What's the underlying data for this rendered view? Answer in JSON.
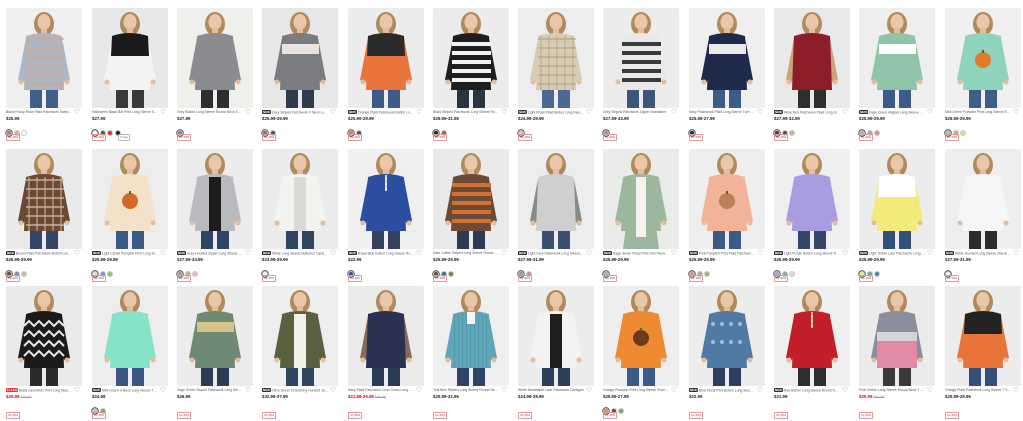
{
  "products": [
    {
      "row": 0,
      "col": 0,
      "title": "Black Friday Rose Plaid Patchwork Sweatshirt Pullover",
      "badge": "",
      "price": "$25.99",
      "orig": "",
      "sale": false,
      "top": "#a9b8c6",
      "accent": "#d9a38f",
      "pattern": "plaid",
      "pants": "#3f5f8c",
      "bg": "#efefef",
      "swatches": [
        "#8a8a8a",
        "#c8b9a6",
        "#ffffff"
      ],
      "promo": "Up 30%",
      "promo2": ""
    },
    {
      "row": 0,
      "col": 1,
      "title": "Halloween Black Bat Print Long Sleeve Sweatshirt",
      "badge": "",
      "price": "$27.99",
      "orig": "",
      "sale": false,
      "top": "#f4f4f4",
      "accent": "#1a1a1a",
      "pattern": "yoke",
      "pants": "#3a3a3a",
      "bg": "#e8e8e8",
      "swatches": [
        "#ffffff",
        "#2a7a3a",
        "#d33",
        "#222"
      ],
      "promo": "Up 30%",
      "promo2": "1 Free"
    },
    {
      "row": 0,
      "col": 2,
      "title": "Grey Button Long Sleeve Round Neck Sweatshirt",
      "badge": "",
      "price": "$27.99",
      "orig": "",
      "sale": false,
      "top": "#8a8c90",
      "accent": "#707277",
      "pattern": "solid",
      "pants": "#2e2e2e",
      "bg": "#eef0ec",
      "swatches": [
        "#888888"
      ],
      "promo": "Up 30%",
      "promo2": ""
    },
    {
      "row": 0,
      "col": 3,
      "title": "Grey Striped Patchwork V Neck Long Sleeve Sweatshirt",
      "badge": "NEW",
      "price": "$25.99-29.99",
      "orig": "",
      "sale": false,
      "top": "#7b7c80",
      "accent": "#e9e4de",
      "pattern": "chest",
      "pants": "#2f3a4a",
      "bg": "#e7e7e7",
      "swatches": [
        "#777777",
        "#4a4f7a"
      ],
      "promo": "Up 30%",
      "promo2": ""
    },
    {
      "row": 0,
      "col": 4,
      "title": "Orange Plaid Patchwork Button Long Sleeve T Shirt",
      "badge": "NEW",
      "price": "$25.99-29.99",
      "orig": "",
      "sale": false,
      "top": "#e8743c",
      "accent": "#2b2b2b",
      "pattern": "yoke",
      "pants": "#3e5c8a",
      "bg": "#ececec",
      "swatches": [
        "#e8743c",
        "#555555"
      ],
      "promo": "Up 30%",
      "promo2": ""
    },
    {
      "row": 0,
      "col": 5,
      "title": "Black Striped Patchwork Long Sleeve Round Neck Top",
      "badge": "",
      "price": "$29.99-31.99",
      "orig": "",
      "sale": false,
      "top": "#1e1e1e",
      "accent": "#f2f2f2",
      "pattern": "stripes",
      "pants": "#2a3342",
      "bg": "#ececec",
      "swatches": [
        "#222222",
        "#7a6a5a"
      ],
      "promo": "Up 30%",
      "promo2": ""
    },
    {
      "row": 0,
      "col": 6,
      "title": "Light Khaki Plaid Button Long Sleeve Round Neck Top",
      "badge": "NEW",
      "price": "$24.99-29.99",
      "orig": "",
      "sale": false,
      "top": "#d8cbb6",
      "accent": "#b8a78c",
      "pattern": "plaid",
      "pants": "#4b6a93",
      "bg": "#ededed",
      "swatches": [
        "#d8cbb6"
      ],
      "promo": "Up 30%",
      "promo2": ""
    },
    {
      "row": 0,
      "col": 7,
      "title": "Grey Striped Patchwork Zipper Sweatshirt",
      "badge": "",
      "price": "$27.99-33.99",
      "orig": "",
      "sale": false,
      "top": "#e9e9e9",
      "accent": "#3a3a3a",
      "pattern": "stripes",
      "pants": "#3c5578",
      "bg": "#ececec",
      "swatches": [
        "#999999"
      ],
      "promo": "Up 30%",
      "promo2": ""
    },
    {
      "row": 0,
      "col": 8,
      "title": "Navy Patchwork Plaid Long Sleeve Turn Down Collar Sweatshirt",
      "badge": "",
      "price": "$25.99-27.99",
      "orig": "",
      "sale": false,
      "top": "#1f2a4a",
      "accent": "#e9e9e9",
      "pattern": "chest",
      "pants": "#3c5b88",
      "bg": "#efefef",
      "swatches": [
        "#1f2a4a"
      ],
      "promo": "Up 30%",
      "promo2": ""
    },
    {
      "row": 0,
      "col": 9,
      "title": "Wine Red Patchwork Plaid Long Sleeve Sweatshirt",
      "badge": "NEW",
      "price": "$27.99-32.99",
      "orig": "",
      "sale": false,
      "top": "#8e1d2a",
      "accent": "#c9a27a",
      "pattern": "sleeves",
      "pants": "#2e2e2e",
      "bg": "#e9e9e9",
      "swatches": [
        "#8e1d2a",
        "#555555",
        "#c9b08e"
      ],
      "promo": "Up 30%",
      "promo2": ""
    },
    {
      "row": 0,
      "col": 10,
      "title": "Sage Green Raglan Long Sleeve Sweatshirt",
      "badge": "NEW",
      "price": "$25.99-29.99",
      "orig": "",
      "sale": false,
      "top": "#8fc4a8",
      "accent": "#ffffff",
      "pattern": "chest",
      "pants": "#3b5b88",
      "bg": "#eeeeee",
      "swatches": [
        "#8fc4a8",
        "#9aa7d6",
        "#e88"
      ],
      "promo": "Up 30%",
      "promo2": ""
    },
    {
      "row": 0,
      "col": 11,
      "title": "Mint Green Pumpkin Print Long Sleeve Sweatshirt",
      "badge": "",
      "price": "$25.99-29.99",
      "orig": "",
      "sale": false,
      "top": "#8fd3bd",
      "accent": "#e07a2c",
      "pattern": "print",
      "pants": "#3e5d89",
      "bg": "#f0f0f0",
      "swatches": [
        "#8fd3bd",
        "#e0a0a0",
        "#e6d48a"
      ],
      "promo": "Up 30%",
      "promo2": ""
    },
    {
      "row": 1,
      "col": 0,
      "title": "Brown Plaid Patchwork Button Long Sleeve T Shirt",
      "badge": "NEW",
      "price": "$25.99-29.99",
      "orig": "",
      "sale": false,
      "top": "#6a4a36",
      "accent": "#cfb79a",
      "pattern": "plaid",
      "pants": "#34466a",
      "bg": "#eaeaea",
      "swatches": [
        "#6a4a36",
        "#7a8bb0",
        "#cfb79a"
      ],
      "promo": "Up 30%",
      "promo2": ""
    },
    {
      "row": 1,
      "col": 1,
      "title": "Light Camel Pumpkin Print Long Sleeve Round Neck Sweatshirt",
      "badge": "NEW",
      "price": "$25.99-29.99",
      "orig": "",
      "sale": false,
      "top": "#f2e2c8",
      "accent": "#d46a2a",
      "pattern": "print",
      "pants": "#3b5a86",
      "bg": "#ededed",
      "swatches": [
        "#f2e2c8",
        "#7a9acb",
        "#9b6"
      ],
      "promo": "Up 30%",
      "promo2": ""
    },
    {
      "row": 1,
      "col": 2,
      "title": "Grey Hooded Zipper Long Sleeve Cardigan",
      "badge": "NEW",
      "price": "$27.99-33.99",
      "orig": "",
      "sale": false,
      "top": "#b8babd",
      "accent": "#1c1c1c",
      "pattern": "cardigan",
      "pants": "#2f4466",
      "bg": "#ececec",
      "swatches": [
        "#999999",
        "#bb8",
        "#e8b8c0"
      ],
      "promo": "Up 30%",
      "promo2": ""
    },
    {
      "row": 1,
      "col": 3,
      "title": "White Long Sleeve Buttoned Cardigan",
      "badge": "NEW",
      "price": "$23.99-29.99",
      "orig": "",
      "sale": false,
      "top": "#f3f3f1",
      "accent": "#d9d9d6",
      "pattern": "cardigan",
      "pants": "#30455f",
      "bg": "#ebebeb",
      "swatches": [
        "#f3f3f1"
      ],
      "promo": "Up 30%",
      "promo2": ""
    },
    {
      "row": 1,
      "col": 4,
      "title": "Royal Blue Button Long Sleeve Round Neck T Shirt",
      "badge": "NEW",
      "price": "$22.99",
      "orig": "",
      "sale": false,
      "top": "#2c4ea0",
      "accent": "#d8d8d8",
      "pattern": "placket",
      "pants": "#33425c",
      "bg": "#efefef",
      "swatches": [
        "#2c4ea0"
      ],
      "promo": "Up 30%",
      "promo2": ""
    },
    {
      "row": 1,
      "col": 5,
      "title": "Dark Coffee Striped Long Sleeve Round Neck T Shirt",
      "badge": "",
      "price": "$25.99-29.99",
      "orig": "",
      "sale": false,
      "top": "#6b4a38",
      "accent": "#d46f2f",
      "pattern": "stripes",
      "pants": "#2e3a52",
      "bg": "#eaeaea",
      "swatches": [
        "#6b4a38",
        "#2f6f8a",
        "#6a8a4a"
      ],
      "promo": "Up 30%",
      "promo2": ""
    },
    {
      "row": 1,
      "col": 6,
      "title": "Light Grey Patchwork Long Sleeve Hooded Top",
      "badge": "NEW",
      "price": "$27.99-31.99",
      "orig": "",
      "sale": false,
      "top": "#cfcfcf",
      "accent": "#8a8a8a",
      "pattern": "sleeves",
      "pants": "#3b5070",
      "bg": "#ededed",
      "swatches": [
        "#999999",
        "#d88"
      ],
      "promo": "Up 30%",
      "promo2": ""
    },
    {
      "row": 1,
      "col": 7,
      "title": "Sage Green Floral Print Two Piece Dress",
      "badge": "NEW",
      "price": "$25.99-29.99",
      "orig": "",
      "sale": false,
      "top": "#9cb79d",
      "accent": "#f3f3f3",
      "pattern": "dress",
      "pants": "#9cb79d",
      "bg": "#e9ece8",
      "swatches": [
        "#9cb79d"
      ],
      "promo": "Up 30%",
      "promo2": ""
    },
    {
      "row": 1,
      "col": 8,
      "title": "Pink Pumpkin Print Plaid Patchwork Sweatshirt",
      "badge": "NEW",
      "price": "$25.99-29.99",
      "orig": "",
      "sale": false,
      "top": "#f2b39a",
      "accent": "#b9815a",
      "pattern": "print",
      "pants": "#3c5a86",
      "bg": "#eeeeee",
      "swatches": [
        "#e88",
        "#aaaaaa",
        "#9b7"
      ],
      "promo": "Up 30%",
      "promo2": ""
    },
    {
      "row": 1,
      "col": 9,
      "title": "Light Purple Button Long Sleeve Round Neck T Shirt",
      "badge": "NEW",
      "price": "$25.99-29.99",
      "orig": "",
      "sale": false,
      "top": "#a99ce0",
      "accent": "#8a7cc8",
      "pattern": "solid",
      "pants": "#34466a",
      "bg": "#efefef",
      "swatches": [
        "#a99ce0",
        "#8ab",
        "#ddd"
      ],
      "promo": "Up 30%",
      "promo2": ""
    },
    {
      "row": 1,
      "col": 10,
      "title": "Light Yellow Lace Patchwork Long Sleeve T Shirt",
      "badge": "NEW",
      "price": "$25.99-29.99",
      "orig": "",
      "sale": false,
      "top": "#f2ea7a",
      "accent": "#ffffff",
      "pattern": "yoke",
      "pants": "#32507a",
      "bg": "#ececec",
      "swatches": [
        "#f2ea7a",
        "#6a9",
        "#48a"
      ],
      "promo": "Up 30%",
      "promo2": ""
    },
    {
      "row": 1,
      "col": 11,
      "title": "White Hooded Long Sleeve Sweatshirt",
      "badge": "NEW",
      "price": "$27.99-31.99",
      "orig": "",
      "sale": false,
      "top": "#f6f6f6",
      "accent": "#dcdcdc",
      "pattern": "solid",
      "pants": "#2b2b2b",
      "bg": "#eeeeee",
      "swatches": [
        "#f6f6f6"
      ],
      "promo": "Up 30%",
      "promo2": ""
    },
    {
      "row": 2,
      "col": 0,
      "title": "Black Geometric Print Long Sleeve T Shirt",
      "badge": "FLASH",
      "price": "$20.99",
      "orig": "$29.99",
      "sale": true,
      "top": "#1b1b1b",
      "accent": "#e8e8e8",
      "pattern": "zigzag",
      "pants": "#2b2b2b",
      "bg": "#eaeaea",
      "swatches": [],
      "promo": "Up 30%",
      "promo2": ""
    },
    {
      "row": 2,
      "col": 1,
      "title": "Mint Green V Neck Long Sleeve T Shirt",
      "badge": "NEW",
      "price": "$24.99",
      "orig": "",
      "sale": false,
      "top": "#86e3c8",
      "accent": "#5ec4a8",
      "pattern": "solid",
      "pants": "#3a5784",
      "bg": "#ededed",
      "swatches": [
        "#86e3c8",
        "#8a5"
      ],
      "promo": "Up 30%",
      "promo2": ""
    },
    {
      "row": 2,
      "col": 2,
      "title": "Sage Green Sequin Patchwork Long Sleeve T Shirt",
      "badge": "",
      "price": "$26.99",
      "orig": "",
      "sale": false,
      "top": "#6e8a72",
      "accent": "#d7c28a",
      "pattern": "chest",
      "pants": "#2d3b54",
      "bg": "#ececec",
      "swatches": [],
      "promo": "Up 30%",
      "promo2": ""
    },
    {
      "row": 2,
      "col": 3,
      "title": "Olive Green Drawstring Hooded Jacket",
      "badge": "NEW",
      "price": "$32.99-37.99",
      "orig": "",
      "sale": false,
      "top": "#59603f",
      "accent": "#f0f0ea",
      "pattern": "cardigan",
      "pants": "#30455f",
      "bg": "#eeeeee",
      "swatches": [],
      "promo": "Up 30%",
      "promo2": ""
    },
    {
      "row": 2,
      "col": 4,
      "title": "Navy Plaid Patchwork Criss Cross Long Sleeve T Shirt",
      "badge": "",
      "price": "$21.99-25.99",
      "orig": "$29.99",
      "sale": true,
      "top": "#2a3152",
      "accent": "#8a6a5a",
      "pattern": "sleeves",
      "pants": "#2b3a55",
      "bg": "#ebebeb",
      "swatches": [],
      "promo": "Up 30%",
      "promo2": ""
    },
    {
      "row": 2,
      "col": 5,
      "title": "Teal Blue Ribbed Long Sleeve Round Neck T Shirt",
      "badge": "",
      "price": "$25.99-32.99",
      "orig": "",
      "sale": false,
      "top": "#5fa6b8",
      "accent": "#f6f6f6",
      "pattern": "rib",
      "pants": "#2f4466",
      "bg": "#efefef",
      "swatches": [],
      "promo": "Up 30%",
      "promo2": ""
    },
    {
      "row": 2,
      "col": 6,
      "title": "White Breathable Lace Patchwork Cardigan",
      "badge": "",
      "price": "$24.99-28.99",
      "orig": "",
      "sale": false,
      "top": "#f3f3f3",
      "accent": "#1e1e1e",
      "pattern": "cardigan",
      "pants": "#2f3e59",
      "bg": "#ececec",
      "swatches": [],
      "promo": "Up 30%",
      "promo2": ""
    },
    {
      "row": 2,
      "col": 7,
      "title": "Orange Pumpkin Print Long Sleeve Round Neck Sweatshirt",
      "badge": "",
      "price": "$25.99-27.99",
      "orig": "",
      "sale": false,
      "top": "#ee8a32",
      "accent": "#6a3a1a",
      "pattern": "print",
      "pants": "#3b5a86",
      "bg": "#eeeeee",
      "swatches": [
        "#ee8a32",
        "#555",
        "#7a7"
      ],
      "promo": "Up 30%",
      "promo2": ""
    },
    {
      "row": 2,
      "col": 8,
      "title": "Blue Floral Print Button Long Sleeve T Shirt",
      "badge": "NEW",
      "price": "$22.99",
      "orig": "",
      "sale": false,
      "top": "#4e7aa4",
      "accent": "#9cc0dc",
      "pattern": "floral",
      "pants": "#2c3f5e",
      "bg": "#ececec",
      "swatches": [],
      "promo": "Up 30%",
      "promo2": ""
    },
    {
      "row": 2,
      "col": 9,
      "title": "Red Button Long Sleeve Round Neck T Shirt",
      "badge": "NEW",
      "price": "$21.99",
      "orig": "",
      "sale": false,
      "top": "#c21f2a",
      "accent": "#e6c08a",
      "pattern": "placket",
      "pants": "#2e2e2e",
      "bg": "#efefef",
      "swatches": [],
      "promo": "Up 30%",
      "promo2": ""
    },
    {
      "row": 2,
      "col": 10,
      "title": "Pink Ombre Long Sleeve Round Neck T Shirt",
      "badge": "",
      "price": "$20.99",
      "orig": "$29.99",
      "sale": true,
      "top": "#8a8d9a",
      "accent": "#f08aa8",
      "pattern": "ombre",
      "pants": "#3a3a3a",
      "bg": "#ebebeb",
      "swatches": [],
      "promo": "Up 30%",
      "promo2": ""
    },
    {
      "row": 2,
      "col": 11,
      "title": "Orange Plaid Patchwork Long Sleeve T Shirt",
      "badge": "",
      "price": "$25.99-29.99",
      "orig": "",
      "sale": false,
      "top": "#e8743c",
      "accent": "#222222",
      "pattern": "yoke",
      "pants": "#34507a",
      "bg": "#ececec",
      "swatches": [],
      "promo": "Up 30%",
      "promo2": ""
    }
  ]
}
